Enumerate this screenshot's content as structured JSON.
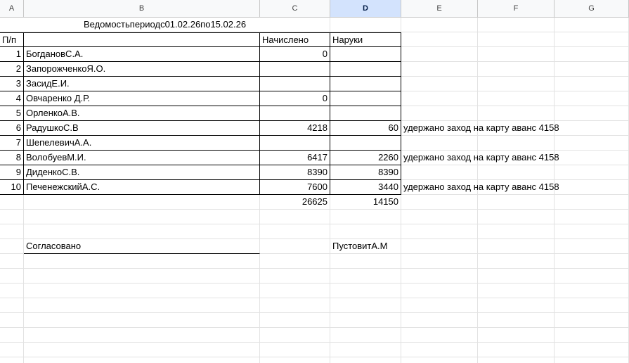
{
  "columns": [
    "A",
    "B",
    "C",
    "D",
    "E",
    "F",
    "G"
  ],
  "selected_column": "D",
  "title": "Ведомостьпериодс01.02.26по15.02.26",
  "header": {
    "num": "П/п",
    "name": "",
    "accrued": "Начислено",
    "cash": "Наруки"
  },
  "rows": [
    {
      "n": "1",
      "name": "БогдановС.А.",
      "accrued": "0",
      "cash": "",
      "note": ""
    },
    {
      "n": "2",
      "name": "ЗапорожченкоЯ.О.",
      "accrued": "",
      "cash": "",
      "note": ""
    },
    {
      "n": "3",
      "name": "ЗасидЕ.И.",
      "accrued": "",
      "cash": "",
      "note": ""
    },
    {
      "n": "4",
      "name": "Овчаренко Д.Р.",
      "accrued": "0",
      "cash": "",
      "note": ""
    },
    {
      "n": "5",
      "name": "ОрленкоА.В.",
      "accrued": "",
      "cash": "",
      "note": ""
    },
    {
      "n": "6",
      "name": "РадушкоС.В",
      "accrued": "4218",
      "cash": "60",
      "note": "удержано  заход на карту аванс 4158"
    },
    {
      "n": "7",
      "name": "ШепелевичА.А.",
      "accrued": "",
      "cash": "",
      "note": ""
    },
    {
      "n": "8",
      "name": "ВолобуевМ.И.",
      "accrued": "6417",
      "cash": "2260",
      "note": "удержано  заход на карту аванс 4158"
    },
    {
      "n": "9",
      "name": "ДиденкоС.В.",
      "accrued": "8390",
      "cash": "8390",
      "note": ""
    },
    {
      "n": "10",
      "name": "ПеченежскийА.С.",
      "accrued": "7600",
      "cash": "3440",
      "note": "удержано  заход на карту аванс 4158"
    }
  ],
  "totals": {
    "accrued": "26625",
    "cash": "14150"
  },
  "approved_label": "Согласовано",
  "signer": "ПустовитА.М"
}
